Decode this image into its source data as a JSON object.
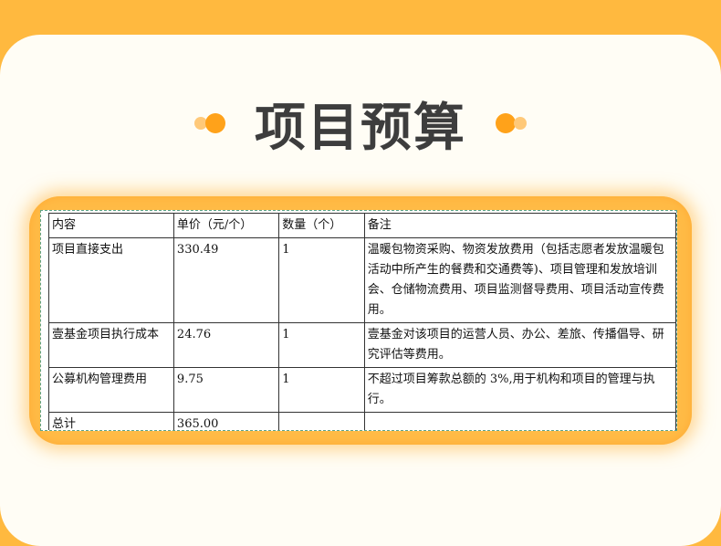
{
  "page": {
    "title": "项目预算",
    "accent_color": "#ffa21a",
    "background_color": "#ffb93f"
  },
  "budget_table": {
    "headers": [
      "内容",
      "单价（元/个）",
      "数量（个）",
      "备注"
    ],
    "rows": [
      {
        "item": "项目直接支出",
        "unit_price": "330.49",
        "quantity": "1",
        "note": "温暖包物资采购、物资发放费用（包括志愿者发放温暖包活动中所产生的餐费和交通费等)、项目管理和发放培训会、仓储物流费用、项目监测督导费用、项目活动宣传费用。"
      },
      {
        "item": "壹基金项目执行成本",
        "unit_price": "24.76",
        "quantity": "1",
        "note": "壹基金对该项目的运营人员、办公、差旅、传播倡导、研究评估等费用。"
      },
      {
        "item": "公募机构管理费用",
        "unit_price": "9.75",
        "quantity": "1",
        "note": "不超过项目筹款总额的 3%,用于机构和项目的管理与执行。"
      }
    ],
    "total": {
      "label": "总计",
      "amount": "365.00",
      "quantity": "",
      "note": ""
    }
  }
}
